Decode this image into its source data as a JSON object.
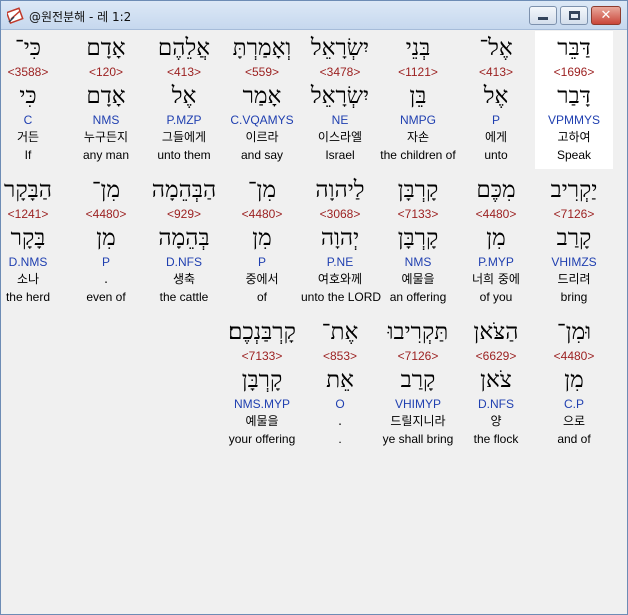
{
  "window": {
    "title": "@원전분해 - 레 1:2",
    "minimize_icon": "minimize-icon",
    "maximize_icon": "maximize-icon",
    "close_icon": "close-icon",
    "close_glyph": "✕"
  },
  "rows": [
    {
      "words": [
        {
          "hebrew": "דַּבֵּר",
          "strong": "<1696>",
          "root": "דָּבַר",
          "parse": "VPMMYS",
          "korean": "고하여",
          "english": "Speak",
          "selected": true
        },
        {
          "hebrew": "אֶל־",
          "strong": "<413>",
          "root": "אֶל",
          "parse": "P",
          "korean": "에게",
          "english": "unto"
        },
        {
          "hebrew": "בְּנֵי",
          "strong": "<1121>",
          "root": "בֵּן",
          "parse": "NMPG",
          "korean": "자손",
          "english": "the children of"
        },
        {
          "hebrew": "יִשְׂרָאֵל",
          "strong": "<3478>",
          "root": "יִשְׂרָאֵל",
          "parse": "NE",
          "korean": "이스라엘",
          "english": "Israel"
        },
        {
          "hebrew": "וְאָמַרְתָּ",
          "strong": "<559>",
          "root": "אָמַר",
          "parse": "C.VQAMYS",
          "korean": "이르라",
          "english": "and say"
        },
        {
          "hebrew": "אֲלֵהֶם",
          "strong": "<413>",
          "root": "אֶל",
          "parse": "P.MZP",
          "korean": "그들에게",
          "english": "unto them"
        },
        {
          "hebrew": "אָדָם",
          "strong": "<120>",
          "root": "אָדָם",
          "parse": "NMS",
          "korean": "누구든지",
          "english": "any man"
        },
        {
          "hebrew": "כִּי־",
          "strong": "<3588>",
          "root": "כִּי",
          "parse": "C",
          "korean": "거든",
          "english": "If"
        }
      ]
    },
    {
      "words": [
        {
          "hebrew": "יַקְרִיב",
          "strong": "<7126>",
          "root": "קָרַב",
          "parse": "VHIMZS",
          "korean": "드리려",
          "english": "bring"
        },
        {
          "hebrew": "מִכֶּם",
          "strong": "<4480>",
          "root": "מִן",
          "parse": "P.MYP",
          "korean": "너희 중에",
          "english": "of you"
        },
        {
          "hebrew": "קָרְבָּן",
          "strong": "<7133>",
          "root": "קָרְבָּן",
          "parse": "NMS",
          "korean": "예물을",
          "english": "an offering"
        },
        {
          "hebrew": "לַיהוָה",
          "strong": "<3068>",
          "root": "יְהוָה",
          "parse": "P.NE",
          "korean": "여호와께",
          "english": "unto the LORD"
        },
        {
          "hebrew": "מִן־",
          "strong": "<4480>",
          "root": "מִן",
          "parse": "P",
          "korean": "중에서",
          "english": "of"
        },
        {
          "hebrew": "הַבְּהֵמָה",
          "strong": "<929>",
          "root": "בְּהֵמָה",
          "parse": "D.NFS",
          "korean": "생축",
          "english": "the cattle"
        },
        {
          "hebrew": "מִן־",
          "strong": "<4480>",
          "root": "מִן",
          "parse": "P",
          "korean": ".",
          "english": "even of"
        },
        {
          "hebrew": "הַבָּקָר",
          "strong": "<1241>",
          "root": "בָּקָר",
          "parse": "D.NMS",
          "korean": "소나",
          "english": "the herd"
        }
      ]
    },
    {
      "words": [
        {
          "hebrew": "וּמִן־",
          "strong": "<4480>",
          "root": "מִן",
          "parse": "C.P",
          "korean": "으로",
          "english": "and of"
        },
        {
          "hebrew": "הַצֹּאן",
          "strong": "<6629>",
          "root": "צֹאן",
          "parse": "D.NFS",
          "korean": "양",
          "english": "the flock"
        },
        {
          "hebrew": "תַּקְרִיבוּ",
          "strong": "<7126>",
          "root": "קָרַב",
          "parse": "VHIMYP",
          "korean": "드릴지니라",
          "english": "ye shall bring"
        },
        {
          "hebrew": "אֶת־",
          "strong": "<853>",
          "root": "אֵת",
          "parse": "O",
          "korean": ".",
          "english": "."
        },
        {
          "hebrew": "קָרְבַּנְכֶם׃",
          "strong": "<7133>",
          "root": "קָרְבָּן",
          "parse": "NMS.MYP",
          "korean": "예물을",
          "english": "your offering"
        }
      ]
    }
  ],
  "colors": {
    "strong_number": "#9b1f1f",
    "parse_code": "#1f3fb0",
    "selected_background": "#ffffff"
  }
}
